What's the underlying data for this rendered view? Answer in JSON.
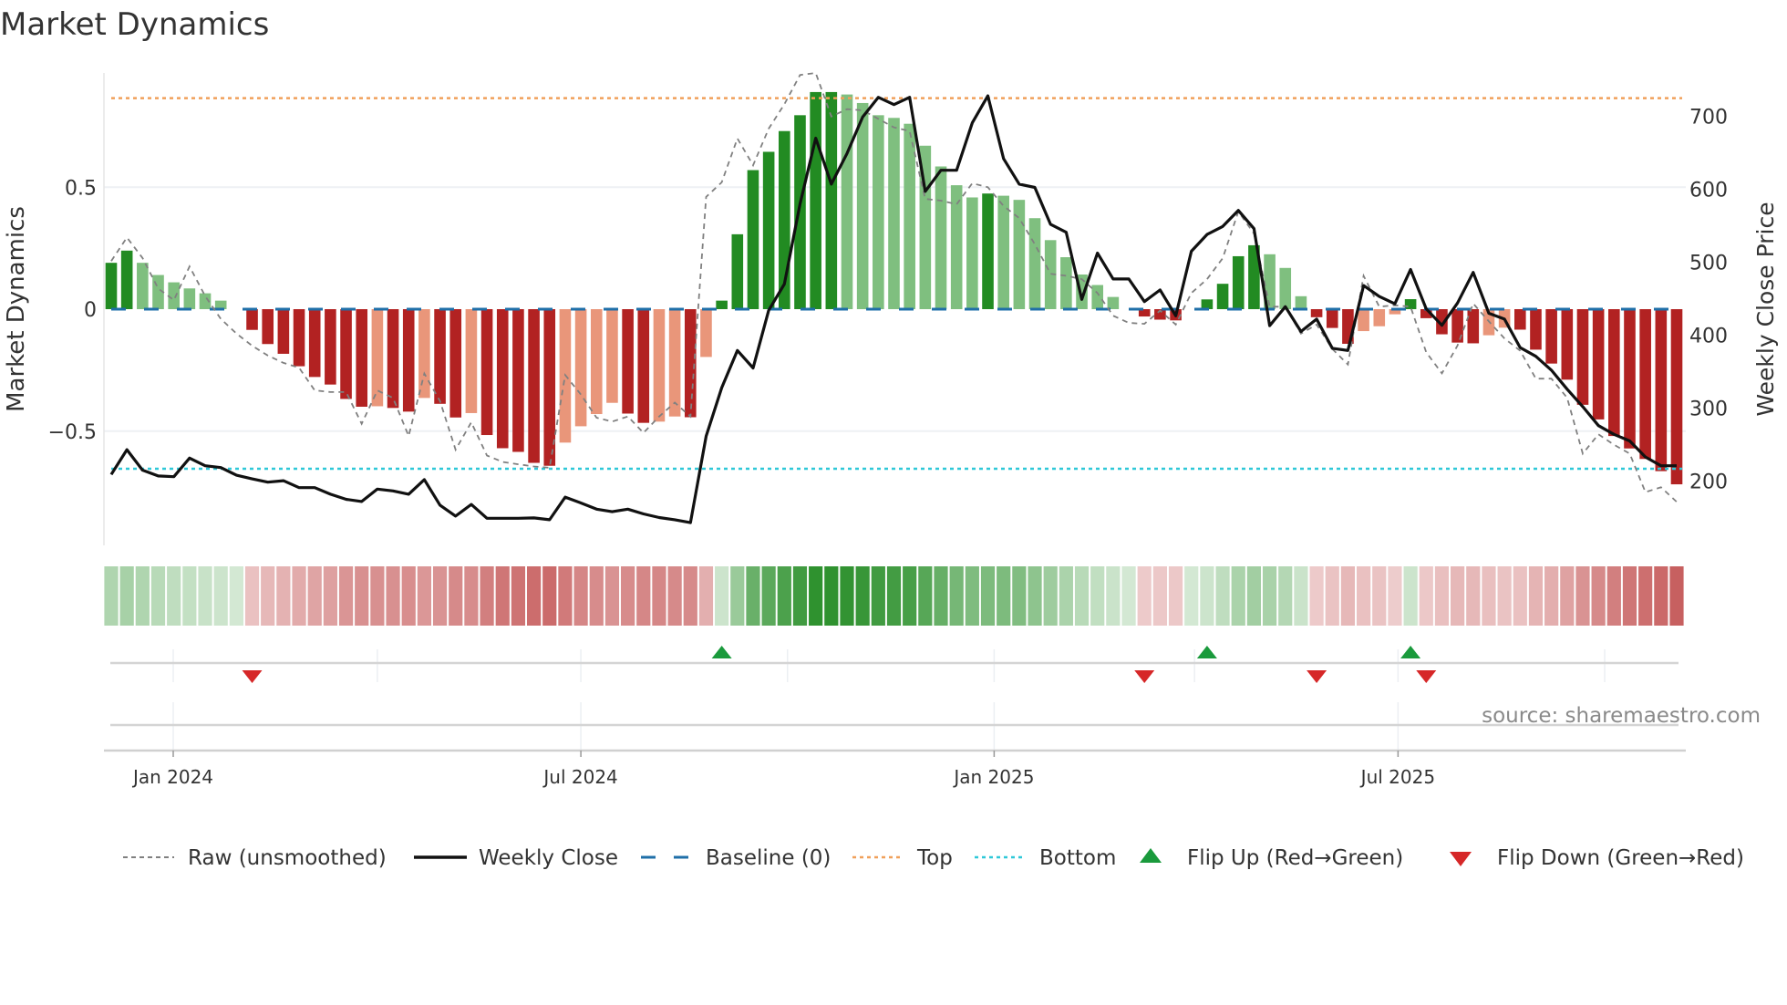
{
  "title": "Market Dynamics",
  "source": "source: sharemaestro.com",
  "colors": {
    "bar_strong_up": "#228b22",
    "bar_weak_up": "#7fbf7f",
    "bar_strong_down": "#b22222",
    "bar_weak_down": "#e9967a",
    "raw": "#808080",
    "close": "#111111",
    "baseline": "#1f6fa8",
    "top": "#f0a05a",
    "bottom": "#2ec8d8",
    "flip_up": "#1a9a3c",
    "flip_down": "#d62728"
  },
  "legend": [
    {
      "key": "raw",
      "label": "Raw (unsmoothed)"
    },
    {
      "key": "close",
      "label": "Weekly Close"
    },
    {
      "key": "baseline",
      "label": "Baseline (0)"
    },
    {
      "key": "top",
      "label": "Top"
    },
    {
      "key": "bottom",
      "label": "Bottom"
    },
    {
      "key": "flip_up",
      "label": "Flip Up (Red→Green)"
    },
    {
      "key": "flip_down",
      "label": "Flip Down (Green→Red)"
    }
  ],
  "chart_data": {
    "type": "bar",
    "title": "Market Dynamics",
    "ylabel": "Market Dynamics",
    "y2label": "Weekly Close Price",
    "ylim": [
      -0.95,
      0.98
    ],
    "y2lim": [
      110,
      760
    ],
    "yticks": [
      {
        "v": 0.5,
        "label": "0.5"
      },
      {
        "v": 0,
        "label": "0"
      },
      {
        "v": -0.5,
        "label": "−0.5"
      }
    ],
    "y2ticks": [
      {
        "v": 700,
        "label": "700"
      },
      {
        "v": 600,
        "label": "600"
      },
      {
        "v": 500,
        "label": "500"
      },
      {
        "v": 400,
        "label": "400"
      },
      {
        "v": 300,
        "label": "300"
      },
      {
        "v": 200,
        "label": "200"
      }
    ],
    "xticks": [
      {
        "week": 4.96,
        "label": "Jan 2024"
      },
      {
        "week": 31.0,
        "label": "Jul 2024"
      },
      {
        "week": 57.4,
        "label": "Jan 2025"
      },
      {
        "week": 83.2,
        "label": "Jul 2025"
      }
    ],
    "minor_xticks": [
      18.0,
      44.2,
      70.2,
      96.4
    ],
    "top_level": 0.865,
    "bottom_level": -0.654,
    "baseline": 0,
    "weeks": 101,
    "market_dynamics": [
      0.19,
      0.24,
      0.19,
      0.14,
      0.11,
      0.085,
      0.065,
      0.035,
      0,
      -0.085,
      -0.143,
      -0.183,
      -0.234,
      -0.278,
      -0.309,
      -0.368,
      -0.4,
      -0.398,
      -0.405,
      -0.42,
      -0.364,
      -0.388,
      -0.444,
      -0.426,
      -0.516,
      -0.57,
      -0.585,
      -0.63,
      -0.642,
      -0.547,
      -0.48,
      -0.43,
      -0.384,
      -0.428,
      -0.466,
      -0.461,
      -0.44,
      -0.443,
      -0.196,
      0.035,
      0.307,
      0.57,
      0.645,
      0.73,
      0.795,
      0.89,
      0.89,
      0.88,
      0.845,
      0.795,
      0.784,
      0.76,
      0.67,
      0.585,
      0.508,
      0.458,
      0.474,
      0.465,
      0.448,
      0.373,
      0.283,
      0.213,
      0.142,
      0.099,
      0.05,
      0,
      -0.03,
      -0.043,
      -0.046,
      0,
      0.04,
      0.104,
      0.217,
      0.262,
      0.225,
      0.169,
      0.053,
      -0.033,
      -0.077,
      -0.142,
      -0.09,
      -0.07,
      -0.021,
      0.041,
      -0.037,
      -0.103,
      -0.137,
      -0.14,
      -0.107,
      -0.076,
      -0.084,
      -0.166,
      -0.223,
      -0.289,
      -0.392,
      -0.452,
      -0.52,
      -0.571,
      -0.614,
      -0.664,
      -0.718
    ],
    "shade": "DDLLLLLLLDDDDDDDDLDDLDDLDDDDDLLLLDDLLDLDDDDDDDDLLLLLLLLLDLLLLLLLLLDDDLDDDDLLLDDDLLLDDDDDLLDDDDDDDDDDD",
    "raw": [
      0.197,
      0.294,
      0.21,
      0.085,
      0.037,
      0.175,
      0.054,
      -0.04,
      -0.1,
      -0.15,
      -0.19,
      -0.22,
      -0.24,
      -0.333,
      -0.34,
      -0.34,
      -0.47,
      -0.333,
      -0.364,
      -0.52,
      -0.264,
      -0.377,
      -0.576,
      -0.464,
      -0.6,
      -0.626,
      -0.636,
      -0.645,
      -0.65,
      -0.27,
      -0.35,
      -0.445,
      -0.461,
      -0.44,
      -0.507,
      -0.44,
      -0.383,
      -0.44,
      0.46,
      0.52,
      0.7,
      0.59,
      0.74,
      0.84,
      0.96,
      0.98,
      0.79,
      0.82,
      0.815,
      0.78,
      0.745,
      0.73,
      0.452,
      0.445,
      0.43,
      0.516,
      0.5,
      0.423,
      0.373,
      0.266,
      0.145,
      0.137,
      0.123,
      0.066,
      -0.027,
      -0.056,
      -0.06,
      -0.006,
      -0.063,
      0.066,
      0.123,
      0.209,
      0.4,
      0.31,
      0.01,
      0.01,
      -0.1,
      -0.063,
      -0.163,
      -0.227,
      0.137,
      0.01,
      0.016,
      0.01,
      -0.177,
      -0.263,
      -0.149,
      0.023,
      -0.05,
      -0.12,
      -0.17,
      -0.285,
      -0.285,
      -0.363,
      -0.592,
      -0.513,
      -0.556,
      -0.592,
      -0.75,
      -0.73,
      -0.79
    ],
    "weekly_close": [
      209,
      243,
      215,
      207,
      206,
      231.5,
      221,
      218.5,
      208,
      203,
      198.5,
      200.5,
      191,
      191,
      182,
      175,
      172,
      189,
      186.5,
      182,
      202,
      167,
      152,
      168,
      149,
      149,
      149,
      149.5,
      147,
      178,
      170,
      161.5,
      158,
      161.5,
      155,
      150,
      147,
      143,
      261.5,
      328,
      379,
      355,
      434,
      470,
      580,
      670,
      607,
      649,
      699,
      726,
      716,
      726,
      597,
      626,
      626,
      691,
      728,
      642,
      607,
      602.5,
      552,
      541,
      449,
      512.5,
      477,
      477,
      446,
      462,
      426.5,
      515,
      538,
      549,
      571,
      546,
      413,
      439,
      405,
      422,
      382,
      379,
      468,
      453,
      443,
      490,
      436,
      413.5,
      444,
      486,
      430,
      422,
      383,
      371,
      352,
      326,
      302,
      276,
      264,
      255,
      233,
      221,
      221
    ],
    "flip_up_weeks": [
      40,
      71,
      84
    ],
    "flip_down_weeks": [
      10,
      67,
      78,
      85
    ]
  }
}
